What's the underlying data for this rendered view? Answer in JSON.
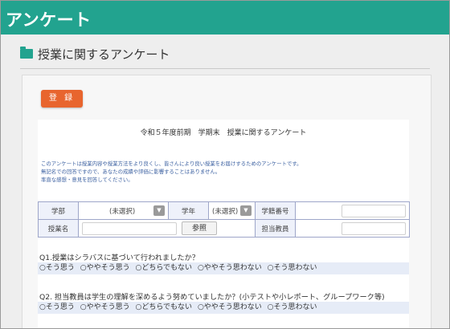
{
  "app": {
    "title": "アンケート"
  },
  "page": {
    "heading": "授業に関するアンケート"
  },
  "toolbar": {
    "register_label": "登 録"
  },
  "form": {
    "title": "令和５年度前期　学期末　授業に関するアンケート",
    "intro": [
      "このアンケートは授業内容や授業方法をより良くし、皆さんにより良い授業をお届けするためのアンケートです。",
      "無記名での回答ですので、あなたの成績や評価に影響することはありません。",
      "率直な感想・意見を回答してください。"
    ],
    "fields": {
      "faculty_label": "学部",
      "faculty_value": "(未選択)",
      "year_label": "学年",
      "year_value": "(未選択)",
      "student_no_label": "学籍番号",
      "course_label": "授業名",
      "browse_label": "参照",
      "teacher_label": "担当教員"
    },
    "questions": [
      {
        "text": "Q1.授業はシラバスに基づいて行われましたか？",
        "options": [
          "○そう思う",
          "○ややそう思う",
          "○どちらでもない",
          "○ややそう思わない",
          "○そう思わない"
        ]
      },
      {
        "text": "Q2. 担当教員は学生の理解を深めるよう努めていましたか？(小テストや小レポート、グループワーク等)",
        "options": [
          "○そう思う",
          "○ややそう思う",
          "○どちらでもない",
          "○ややそう思わない",
          "○そう思わない"
        ]
      }
    ]
  },
  "colors": {
    "accent": "#22a38f",
    "button": "#e8652e"
  }
}
